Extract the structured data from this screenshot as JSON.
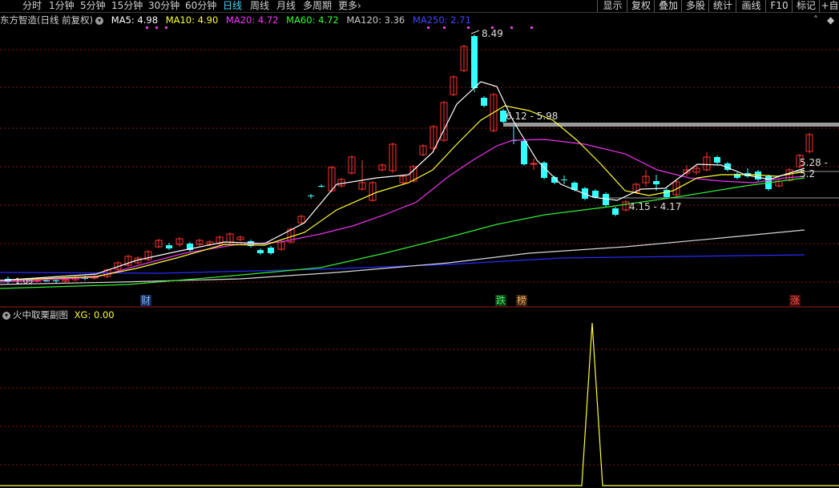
{
  "toolbar": {
    "periods": [
      "分时",
      "1分钟",
      "5分钟",
      "15分钟",
      "30分钟",
      "60分钟",
      "日线",
      "周线",
      "月线",
      "多周期",
      "更多"
    ],
    "active_period": "日线",
    "more_arrow": "›",
    "right_buttons": [
      "显示",
      "复权",
      "叠加",
      "多股",
      "统计",
      "画线",
      "F10",
      "标记",
      "+自"
    ]
  },
  "main": {
    "title": "东方智造(日线 前复权)",
    "ma_labels": [
      {
        "text": "MA5: 4.98",
        "color": "#ffffff"
      },
      {
        "text": "MA10: 4.90",
        "color": "#ffff33"
      },
      {
        "text": "MA20: 4.72",
        "color": "#ff33ff"
      },
      {
        "text": "MA60: 4.72",
        "color": "#33ff33"
      },
      {
        "text": "MA120: 3.36",
        "color": "#c8c8c8"
      },
      {
        "text": "MA250: 2.71",
        "color": "#3333ff"
      }
    ],
    "annotations": {
      "high": "8.49",
      "resistance": "6.12 - 5.98",
      "support": "4.15 - 4.17",
      "right_range": "5.28 - 5.2",
      "start_value": "1.09"
    },
    "event_tags": [
      {
        "text": "财",
        "color": "#6ab0ff"
      },
      {
        "text": "跌",
        "color": "#33dd55"
      },
      {
        "text": "榜",
        "color": "#ffb060"
      },
      {
        "text": "涨",
        "color": "#ff4444"
      }
    ]
  },
  "sub": {
    "title": "火中取栗副图",
    "xg_label": "XG: 0.00"
  },
  "colors": {
    "up": "#ff3333",
    "down": "#33ffff",
    "grid": "#8a1a1a",
    "active_tab": "#3fd8ff"
  }
}
